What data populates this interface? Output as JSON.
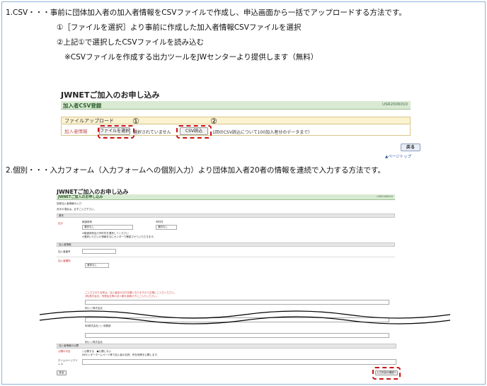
{
  "lines": {
    "line1": "1.CSV・・・事前に団体加入者の加入者情報をCSVファイルで作成し、申込画面から一括でアップロードする方法です。",
    "line2": "①［ファイルを選択］より事前に作成した加入者情報CSVファイルを選択",
    "line3": "②上記①で選択したCSVファイルを読み込む",
    "line4": "※CSVファイルを作成する出力ツールをJWセンターより提供します（無料）",
    "line5": "2.個別・・・入力フォーム（入力フォームへの個別入力）より団体加入者20者の情報を連続で入力する方法です。"
  },
  "screen1": {
    "title": "JWNETご加入のお申し込み",
    "section_title": "加入者CSV登録",
    "screen_id": "USR2006010",
    "upload_header": "ファイルアップロード",
    "field_label": "加入者情報",
    "file_button": "ファイルを選択",
    "no_file_text": "選択されていません",
    "csv_button": "CSV読込",
    "csv_note": "1回のCSV読込について100加入者分のデータまで）",
    "back_button": "戻る",
    "page_top_link": "▲ページトップ",
    "marker1": "①",
    "marker2": "②"
  },
  "screen2": {
    "title": "JWNETご加入のお申し込み",
    "section_title": "JWNETご加入のお申し込み",
    "screen_id": "USR2006020",
    "sub_title": "団体加入者情報の入力",
    "required_note": "赤字の項目は、必ずご入力下さい。",
    "section_basic": "基本",
    "label_kubun": "区分",
    "prefecture_label": "都道府県",
    "city_label": "市町村",
    "select_placeholder": "選択なし",
    "note_a": "※都道府県及び市町村を選択してください",
    "note_b": "※選択いただいた情報を元にセンターで確認させていただきます。",
    "section_member": "加入者情報",
    "label_member_no": "加入者番号",
    "label_member_type": "加入者種別",
    "red_note_1": "ご入力された名称は、加入者証の交付名義となりますので正確にご入力ください。",
    "red_note_2": "(例)株式会社、有限会社等の法人格を省略せずにご入力ください。",
    "example_1": "例)○○株式会社",
    "example_2": "例)株式会社○○ 総務部",
    "example_3": "例)○○株式会社"
  },
  "screen3": {
    "section_title": "加入者情報の公開",
    "label_publish": "公開の可否",
    "publish_options": "○公開する　●公開しない",
    "publish_note": "JWセンターホームページ等で加入者の名称、所在地等を公開します。",
    "label_homepage": "ホームページアドレス",
    "back_button": "戻る",
    "next_button": "入力内容の確認へ"
  }
}
